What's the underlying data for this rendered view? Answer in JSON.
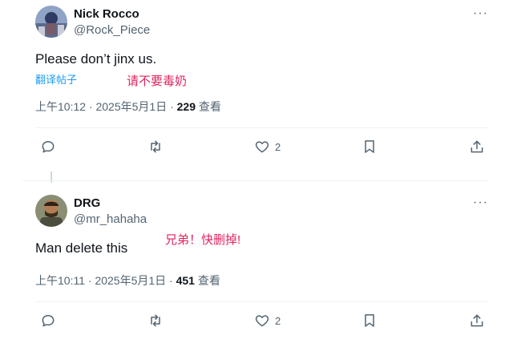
{
  "tweets": [
    {
      "name": "Nick Rocco",
      "handle": "@Rock_Piece",
      "more": "···",
      "text": "Please don’t jinx us.",
      "translate": "翻译帖子",
      "note": "请不要毒奶",
      "time": "上午10:12 · 2025年5月1日 · ",
      "views": "229",
      "views_label": " 查看",
      "likes": "2",
      "colors": {
        "avatar_bg": "#7a86a6",
        "avatar_accent": "#2f3b63"
      }
    },
    {
      "name": "DRG",
      "handle": "@mr_hahaha",
      "more": "···",
      "text": "Man delete this",
      "note": "兄弟！快删掉!",
      "time": "上午10:11 · 2025年5月1日 · ",
      "views": "451",
      "views_label": " 查看",
      "likes": "2",
      "colors": {
        "avatar_bg": "#6b5a3e",
        "avatar_accent": "#2b2418"
      }
    }
  ],
  "icons": [
    "reply-icon",
    "retweet-icon",
    "like-icon",
    "bookmark-icon",
    "share-icon",
    "more-icon"
  ]
}
